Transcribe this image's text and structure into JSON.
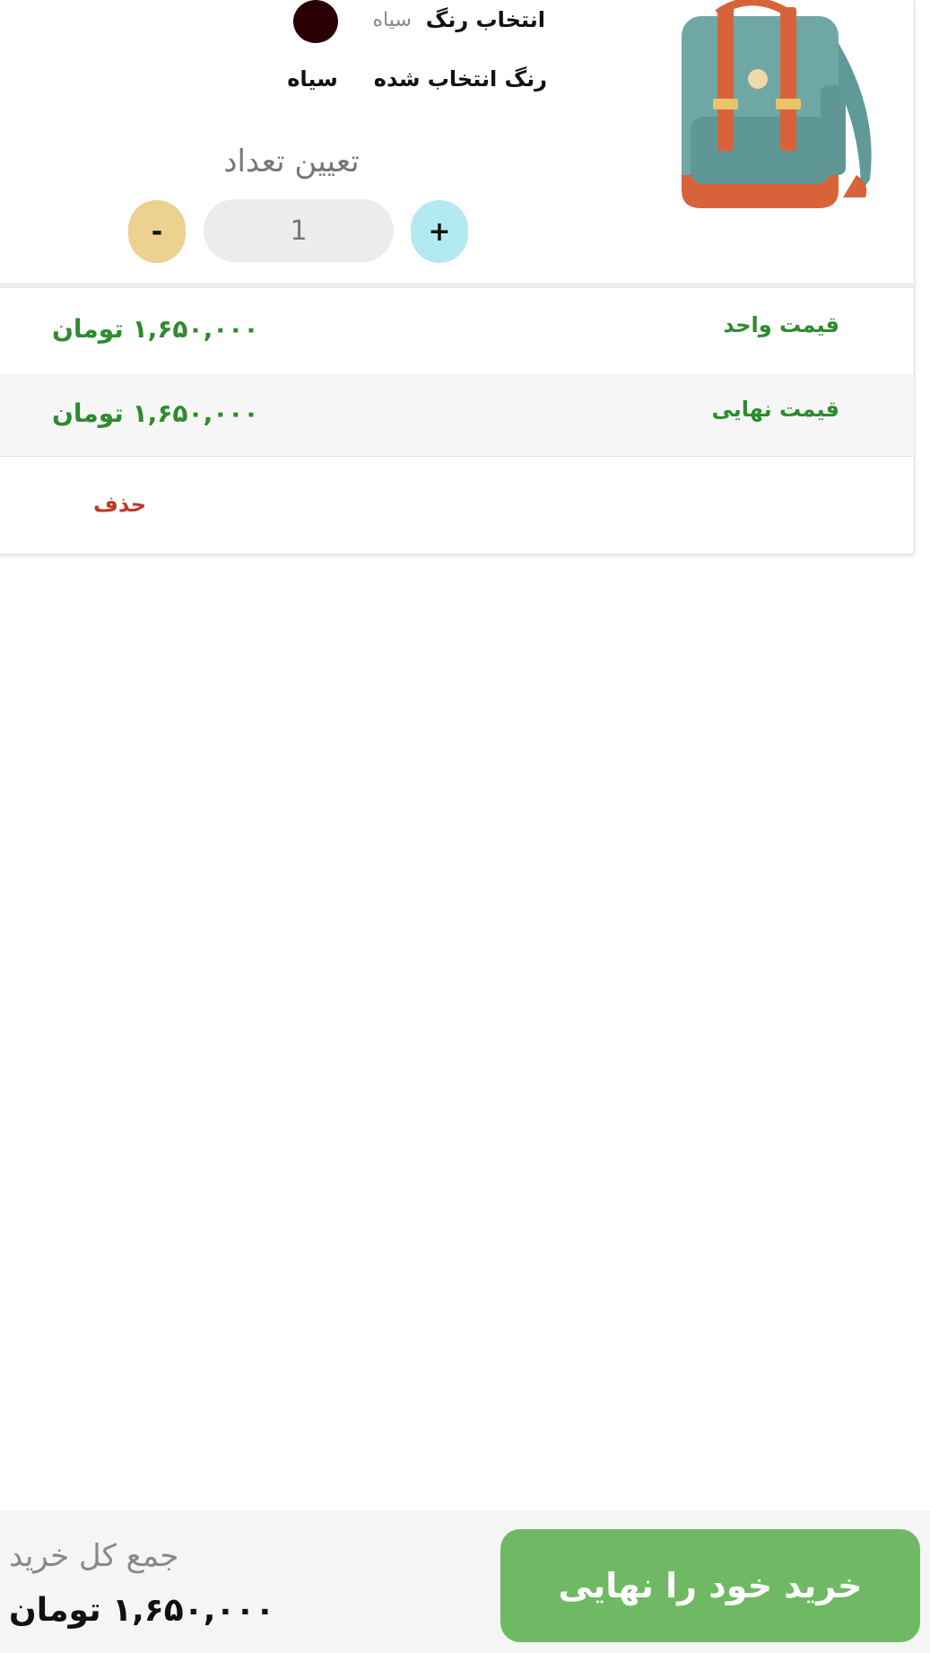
{
  "cart_item": {
    "color_select_label": "انتخاب رنگ",
    "color_option_name": "سیاه",
    "swatch_color": "#2a0005",
    "selected_color_label": "رنگ انتخاب شده",
    "selected_color_value": "سیاه",
    "quantity_title": "تعیین تعداد",
    "plus_label": "+",
    "minus_label": "-",
    "quantity": "1",
    "unit_price_label": "قیمت واحد",
    "unit_price_value": "۱,۶۵۰,۰۰۰ تومان",
    "final_price_label": "قیمت نهایی",
    "final_price_value": "۱,۶۵۰,۰۰۰ تومان",
    "delete_label": "حذف"
  },
  "footer": {
    "total_label": "جمع کل خرید",
    "total_value": "۱,۶۵۰,۰۰۰ تومان",
    "checkout_label": "خرید خود را نهایی"
  },
  "colors": {
    "accent_green": "#70b964",
    "price_green": "#2e8b2e",
    "delete_red": "#c0392b"
  }
}
